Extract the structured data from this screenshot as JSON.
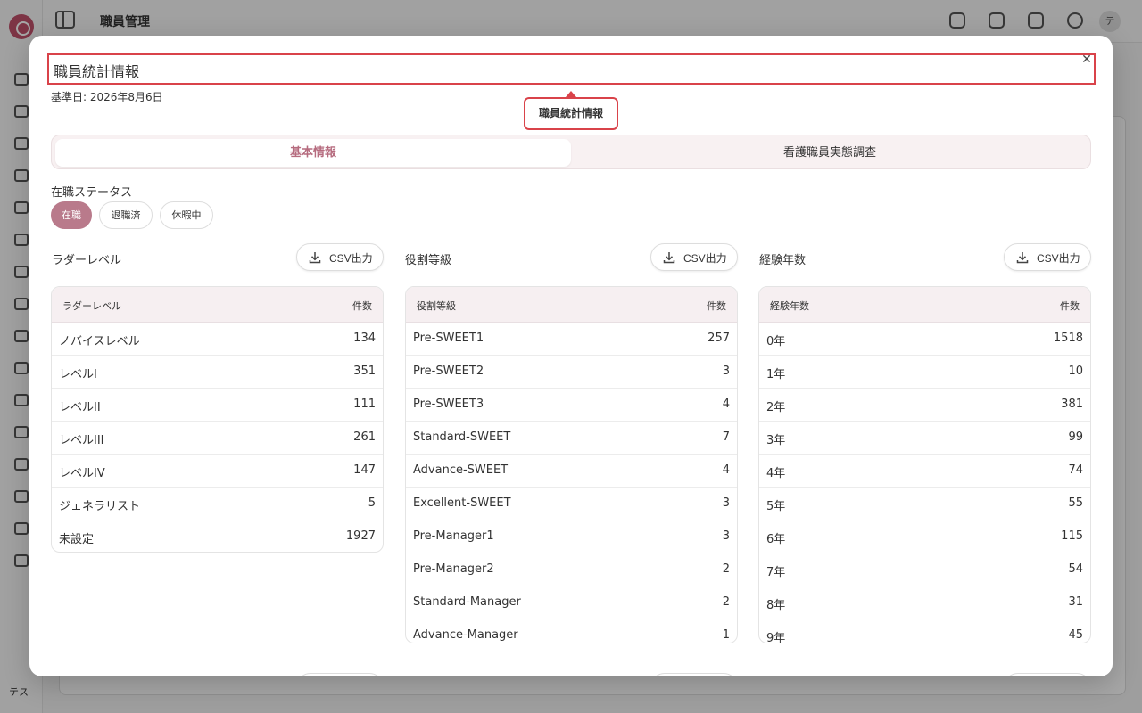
{
  "app": {
    "header_title": "職員管理",
    "sidebar_footer": "テス",
    "avatar_initial": "テ"
  },
  "modal": {
    "title": "職員統計情報",
    "reference_date": "基準日: 2026年8月6日",
    "tooltip": "職員統計情報",
    "close_icon": "close-icon",
    "tabs": [
      {
        "label": "基本情報",
        "active": true
      },
      {
        "label": "看護職員実態調査",
        "active": false
      }
    ],
    "status": {
      "label": "在職ステータス",
      "chips": [
        {
          "label": "在職",
          "active": true
        },
        {
          "label": "退職済",
          "active": false
        },
        {
          "label": "休暇中",
          "active": false
        }
      ]
    },
    "csv_label": "CSV出力",
    "sections": [
      {
        "title": "ラダーレベル",
        "headers": [
          "ラダーレベル",
          "件数"
        ],
        "rows": [
          [
            "ノバイスレベル",
            "134"
          ],
          [
            "レベルI",
            "351"
          ],
          [
            "レベルII",
            "111"
          ],
          [
            "レベルIII",
            "261"
          ],
          [
            "レベルIV",
            "147"
          ],
          [
            "ジェネラリスト",
            "5"
          ],
          [
            "未設定",
            "1927"
          ]
        ]
      },
      {
        "title": "役割等級",
        "headers": [
          "役割等級",
          "件数"
        ],
        "rows": [
          [
            "Pre-SWEET1",
            "257"
          ],
          [
            "Pre-SWEET2",
            "3"
          ],
          [
            "Pre-SWEET3",
            "4"
          ],
          [
            "Standard-SWEET",
            "7"
          ],
          [
            "Advance-SWEET",
            "4"
          ],
          [
            "Excellent-SWEET",
            "3"
          ],
          [
            "Pre-Manager1",
            "3"
          ],
          [
            "Pre-Manager2",
            "2"
          ],
          [
            "Standard-Manager",
            "2"
          ],
          [
            "Advance-Manager",
            "1"
          ]
        ]
      },
      {
        "title": "経験年数",
        "headers": [
          "経験年数",
          "件数"
        ],
        "rows": [
          [
            "0年",
            "1518"
          ],
          [
            "1年",
            "10"
          ],
          [
            "2年",
            "381"
          ],
          [
            "3年",
            "99"
          ],
          [
            "4年",
            "74"
          ],
          [
            "5年",
            "55"
          ],
          [
            "6年",
            "115"
          ],
          [
            "7年",
            "54"
          ],
          [
            "8年",
            "31"
          ],
          [
            "9年",
            "45"
          ]
        ]
      }
    ]
  },
  "colors": {
    "accent": "#b97a8b",
    "highlight": "#d9434a",
    "table_header_bg": "#f6eff1"
  }
}
